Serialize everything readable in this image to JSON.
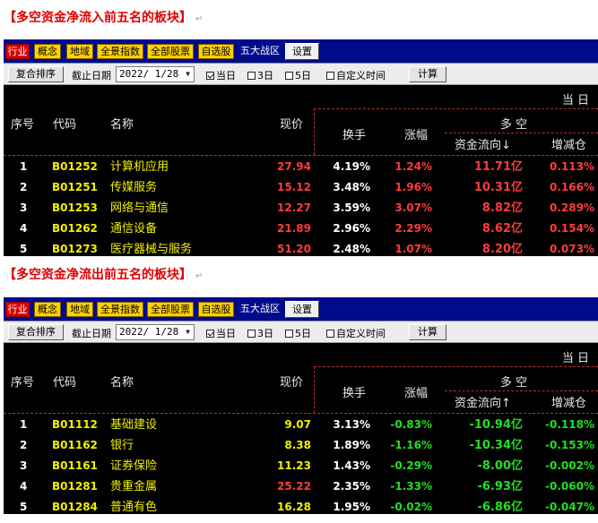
{
  "sections": [
    {
      "heading": "【多空资金净流入前五名的板块】",
      "tabs": [
        "行业",
        "概念",
        "地域",
        "全景指数",
        "全部股票",
        "自选股",
        "五大战区",
        "设置"
      ],
      "toolbar": {
        "sort_button": "复合排序",
        "date_label": "截止日期",
        "date_value": "2022/ 1/28",
        "check_today": "当日",
        "check_3day": "3日",
        "check_5day": "5日",
        "check_custom": "自定义时间",
        "calc_button": "计算"
      },
      "header": {
        "top_right": "当  日",
        "seq": "序号",
        "code": "代码",
        "name": "名称",
        "price": "现价",
        "turnover": "换手",
        "change": "涨幅",
        "group": "多  空",
        "flow": "资金流向↓",
        "delta": "增减仓"
      },
      "rows": [
        {
          "idx": "1",
          "code": "B01252",
          "name": "计算机应用",
          "price": "27.94",
          "turnover": "4.19%",
          "change": "1.24%",
          "flow": "11.71亿",
          "delta": "0.113%"
        },
        {
          "idx": "2",
          "code": "B01251",
          "name": "传媒服务",
          "price": "15.12",
          "turnover": "3.48%",
          "change": "1.96%",
          "flow": "10.31亿",
          "delta": "0.166%"
        },
        {
          "idx": "3",
          "code": "B01253",
          "name": "网络与通信",
          "price": "12.27",
          "turnover": "3.59%",
          "change": "3.07%",
          "flow": "8.82亿",
          "delta": "0.289%"
        },
        {
          "idx": "4",
          "code": "B01262",
          "name": "通信设备",
          "price": "21.89",
          "turnover": "2.96%",
          "change": "2.29%",
          "flow": "8.62亿",
          "delta": "0.154%"
        },
        {
          "idx": "5",
          "code": "B01273",
          "name": "医疗器械与服务",
          "price": "51.20",
          "turnover": "2.48%",
          "change": "1.07%",
          "flow": "8.20亿",
          "delta": "0.073%"
        }
      ]
    },
    {
      "heading": "【多空资金净流出前五名的板块】",
      "tabs": [
        "行业",
        "概念",
        "地域",
        "全景指数",
        "全部股票",
        "自选股",
        "五大战区",
        "设置"
      ],
      "toolbar": {
        "sort_button": "复合排序",
        "date_label": "截止日期",
        "date_value": "2022/ 1/28",
        "check_today": "当日",
        "check_3day": "3日",
        "check_5day": "5日",
        "check_custom": "自定义时间",
        "calc_button": "计算"
      },
      "header": {
        "top_right": "当  日",
        "seq": "序号",
        "code": "代码",
        "name": "名称",
        "price": "现价",
        "turnover": "换手",
        "change": "涨幅",
        "group": "多  空",
        "flow": "资金流向↑",
        "delta": "增减仓"
      },
      "rows": [
        {
          "idx": "1",
          "code": "B01112",
          "name": "基础建设",
          "price": "9.07",
          "turnover": "3.13%",
          "change": "-0.83%",
          "flow": "-10.94亿",
          "delta": "-0.118%"
        },
        {
          "idx": "2",
          "code": "B01162",
          "name": "银行",
          "price": "8.38",
          "turnover": "1.89%",
          "change": "-1.16%",
          "flow": "-10.34亿",
          "delta": "-0.153%"
        },
        {
          "idx": "3",
          "code": "B01161",
          "name": "证券保险",
          "price": "11.23",
          "turnover": "1.43%",
          "change": "-0.29%",
          "flow": "-8.00亿",
          "delta": "-0.002%"
        },
        {
          "idx": "4",
          "code": "B01281",
          "name": "贵重金属",
          "price": "25.22",
          "turnover": "2.35%",
          "change": "-1.33%",
          "flow": "-6.93亿",
          "delta": "-0.060%"
        },
        {
          "idx": "5",
          "code": "B01284",
          "name": "普通有色",
          "price": "16.28",
          "turnover": "1.95%",
          "change": "-0.02%",
          "flow": "-6.86亿",
          "delta": "-0.047%"
        }
      ]
    }
  ],
  "colors": {
    "up": "#ff3c3c",
    "down": "#20e020",
    "code": "#f0f000",
    "tabbar": "#000b8c"
  }
}
